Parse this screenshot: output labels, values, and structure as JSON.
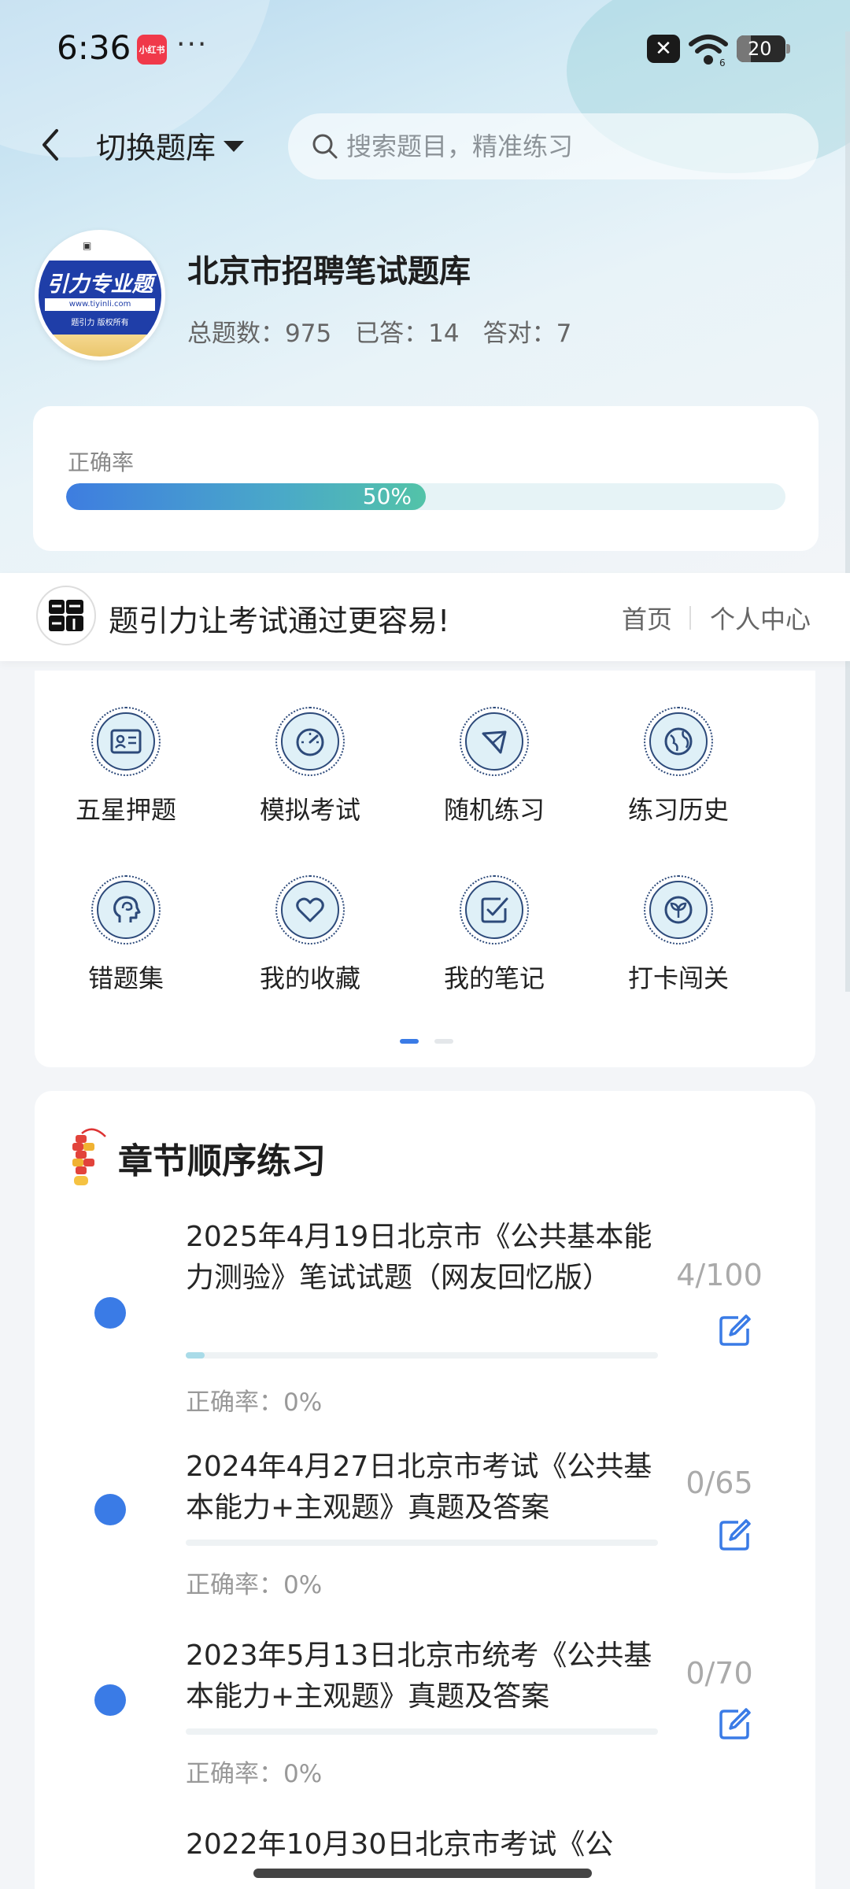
{
  "status_bar": {
    "time": "6:36",
    "app_badge": "小红书",
    "more": "···",
    "battery": "20"
  },
  "header": {
    "switch_label": "切换题库",
    "search_placeholder": "搜索题目，精准练习"
  },
  "bank": {
    "logo_text": "引力专业题",
    "logo_url": "www.tiyinli.com",
    "logo_small": "题引力 版权所有",
    "title": "北京市招聘笔试题库",
    "total_label": "总题数：975",
    "answered_label": "已答：14",
    "correct_label": "答对：7"
  },
  "accuracy": {
    "label": "正确率",
    "value_text": "50%",
    "value": 0.5
  },
  "slogan": {
    "text": "题引力让考试通过更容易!",
    "nav_home": "首页",
    "nav_me": "个人中心"
  },
  "grid": {
    "items": [
      {
        "label": "五星押题",
        "icon": "id-card-icon"
      },
      {
        "label": "模拟考试",
        "icon": "speedometer-icon"
      },
      {
        "label": "随机练习",
        "icon": "network-icon"
      },
      {
        "label": "练习历史",
        "icon": "globe-icon"
      },
      {
        "label": "错题集",
        "icon": "brain-head-icon"
      },
      {
        "label": "我的收藏",
        "icon": "heart-icon"
      },
      {
        "label": "我的笔记",
        "icon": "checklist-icon"
      },
      {
        "label": "打卡闯关",
        "icon": "sprout-icon"
      }
    ],
    "page": 1,
    "pages": 2
  },
  "chapters": {
    "title": "章节顺序练习",
    "items": [
      {
        "name": "2025年4月19日北京市《公共基本能力测验》笔试试题（网友回忆版）",
        "accuracy": "正确率：0%",
        "count": "4/100",
        "progress": 0.04
      },
      {
        "name": "2024年4月27日北京市考试《公共基本能力+主观题》真题及答案",
        "accuracy": "正确率：0%",
        "count": "0/65",
        "progress": 0
      },
      {
        "name": "2023年5月13日北京市统考《公共基本能力+主观题》真题及答案",
        "accuracy": "正确率：0%",
        "count": "0/70",
        "progress": 0
      },
      {
        "name": "2022年10月30日北京市考试《公",
        "accuracy": "",
        "count": "",
        "progress": 0
      }
    ]
  },
  "colors": {
    "accent": "#3a7be6",
    "icon_stroke": "#2d4a7a",
    "icon_fill": "#dff0f7"
  }
}
